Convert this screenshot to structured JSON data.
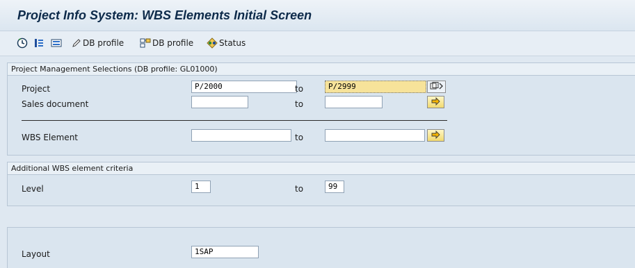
{
  "app": {
    "title": "Project Info System: WBS Elements Initial Screen"
  },
  "toolbar": {
    "execute_icon": "execute-clock-icon",
    "selection_icon": "multiple-selection-icon",
    "variant_icon": "variant-icon",
    "db_profile_1": "DB profile",
    "db_profile_2": "DB profile",
    "status": "Status"
  },
  "group1": {
    "header": "Project Management Selections (DB profile: GL01000)",
    "rows": {
      "project": {
        "label": "Project",
        "from": "P/2000",
        "to_label": "to",
        "to": "P/2999"
      },
      "sales": {
        "label": "Sales document",
        "from": "",
        "to_label": "to",
        "to": ""
      },
      "wbs": {
        "label": "WBS Element",
        "from": "",
        "to_label": "to",
        "to": ""
      }
    }
  },
  "group2": {
    "header": "Additional WBS element criteria",
    "level": {
      "label": "Level",
      "from": "1",
      "to_label": "to",
      "to": "99"
    }
  },
  "layout_group": {
    "label": "Layout",
    "value": "1SAP"
  },
  "colors": {
    "accent": "#f7e39a",
    "title": "#0d2a4a",
    "background": "#dfe8f1"
  }
}
